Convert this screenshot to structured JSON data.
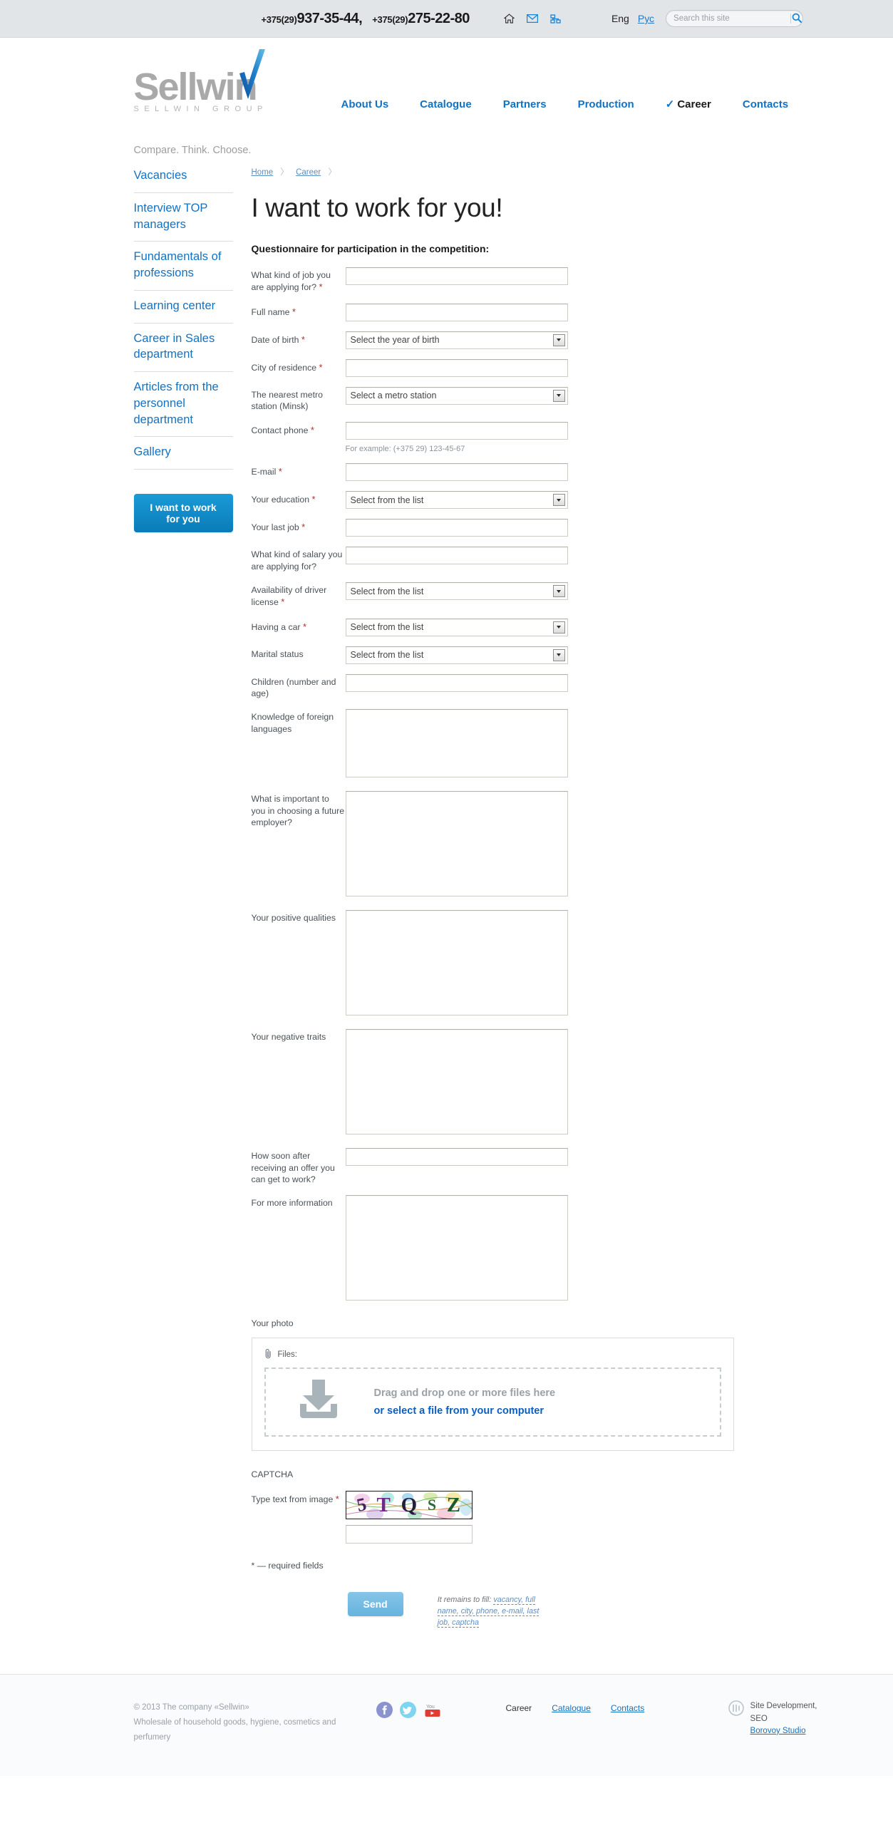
{
  "topbar": {
    "phone1_prefix": "+375(29)",
    "phone1_number": "937-35-44,",
    "phone2_prefix": "+375(29)",
    "phone2_number": "275-22-80",
    "icons": [
      "home-icon",
      "mail-icon",
      "sitemap-icon"
    ],
    "lang_current": "Eng",
    "lang_other": "Рус",
    "search_placeholder": "Search this site",
    "search_value": ""
  },
  "brand": {
    "logo_part1": "Sell",
    "logo_part2": "in",
    "logo_sub": "SELLWIN GROUP",
    "tagline": "Compare. Think. Choose."
  },
  "nav": [
    {
      "label": "About Us",
      "active": false
    },
    {
      "label": "Catalogue",
      "active": false
    },
    {
      "label": "Partners",
      "active": false
    },
    {
      "label": "Production",
      "active": false
    },
    {
      "label": "Career",
      "active": true
    },
    {
      "label": "Contacts",
      "active": false
    }
  ],
  "sidebar": {
    "items": [
      "Vacancies",
      "Interview TOP managers",
      "Fundamentals of professions",
      "Learning center",
      "Career in Sales department",
      "Articles from the personnel department",
      "Gallery"
    ],
    "cta_label": "I want to work for you"
  },
  "breadcrumb": {
    "home": "Home",
    "career": "Career",
    "separator": "〉"
  },
  "main": {
    "title": "I want to work for you!",
    "questionnaire_heading": "Questionnaire for participation in the competition:",
    "phone_hint": "For example: (+375 29) 123-45-67",
    "photo_label": "Your photo",
    "required_note": "* — required fields"
  },
  "fields": [
    {
      "label": "What kind of job you are applying for?",
      "required": true,
      "type": "text",
      "value": ""
    },
    {
      "label": "Full name",
      "required": true,
      "type": "text",
      "value": ""
    },
    {
      "label": "Date of birth",
      "required": true,
      "type": "select",
      "value": "Select the year of birth"
    },
    {
      "label": "City of residence",
      "required": true,
      "type": "text",
      "value": ""
    },
    {
      "label": "The nearest metro station (Minsk)",
      "required": false,
      "type": "select",
      "value": "Select a metro station"
    },
    {
      "label": "Contact phone",
      "required": true,
      "type": "text",
      "value": ""
    },
    {
      "label": "E-mail",
      "required": true,
      "type": "text",
      "value": ""
    },
    {
      "label": "Your education",
      "required": true,
      "type": "select",
      "value": "Select from the list"
    },
    {
      "label": "Your last job",
      "required": true,
      "type": "text",
      "value": ""
    },
    {
      "label": "What kind of salary you are applying for?",
      "required": false,
      "type": "text",
      "value": ""
    },
    {
      "label": "Availability of driver license",
      "required": true,
      "type": "select",
      "value": "Select from the list"
    },
    {
      "label": "Having a car",
      "required": true,
      "type": "select",
      "value": "Select from the list"
    },
    {
      "label": "Marital status",
      "required": false,
      "type": "select",
      "value": "Select from the list"
    },
    {
      "label": "Children (number and age)",
      "required": false,
      "type": "text",
      "value": ""
    },
    {
      "label": "Knowledge of foreign languages",
      "required": false,
      "type": "textarea",
      "value": ""
    },
    {
      "label": "What is important to you in choosing a future employer?",
      "required": false,
      "type": "textarea-tall",
      "value": ""
    },
    {
      "label": "Your positive qualities",
      "required": false,
      "type": "textarea-tall",
      "value": ""
    },
    {
      "label": "Your negative traits",
      "required": false,
      "type": "textarea-tall",
      "value": ""
    },
    {
      "label": "How soon after receiving an offer you can get to work?",
      "required": false,
      "type": "text",
      "value": ""
    },
    {
      "label": "For more information",
      "required": false,
      "type": "textarea-tall",
      "value": ""
    }
  ],
  "upload": {
    "files_label": "Files:",
    "clip_icon": "paperclip-icon",
    "drop_icon": "download-arrow-icon",
    "drag_text": "Drag and drop one or more files here",
    "select_text": "or select a file from your computer"
  },
  "captcha": {
    "section_title": "CAPTCHA",
    "label": "Type text from image",
    "required": true,
    "code": "5TQSZ",
    "chars": [
      {
        "ch": "5",
        "color": "#4a2060",
        "rot": -12,
        "size": 26
      },
      {
        "ch": "T",
        "color": "#6e2a84",
        "rot": 0,
        "size": 29
      },
      {
        "ch": "Q",
        "color": "#231f3a",
        "rot": 0,
        "size": 29
      },
      {
        "ch": "S",
        "color": "#2f6b3a",
        "rot": 0,
        "size": 22
      },
      {
        "ch": "Z",
        "color": "#1d5a2a",
        "rot": 0,
        "size": 29
      }
    ],
    "input_value": ""
  },
  "submit": {
    "send_label": "Send",
    "remains_prefix": "It remains to fill:",
    "remains_fields": "vacancy, full name, city, phone, e-mail, last job, captcha"
  },
  "footer": {
    "copyright": "© 2013 The company «Sellwin»",
    "description": "Wholesale of household goods, hygiene, cosmetics and perfumery",
    "social": [
      "facebook-icon",
      "twitter-icon",
      "youtube-icon"
    ],
    "nav_current": "Career",
    "nav_links": [
      "Catalogue",
      "Contacts"
    ],
    "dev_line1": "Site Development,",
    "dev_line2": "SEO",
    "dev_studio": "Borovoy Studio"
  },
  "colors": {
    "brand_blue": "#1272c4",
    "logo_gray": "#a9a9a9",
    "accent": "#0a7bb8",
    "required_red": "#a33333"
  }
}
